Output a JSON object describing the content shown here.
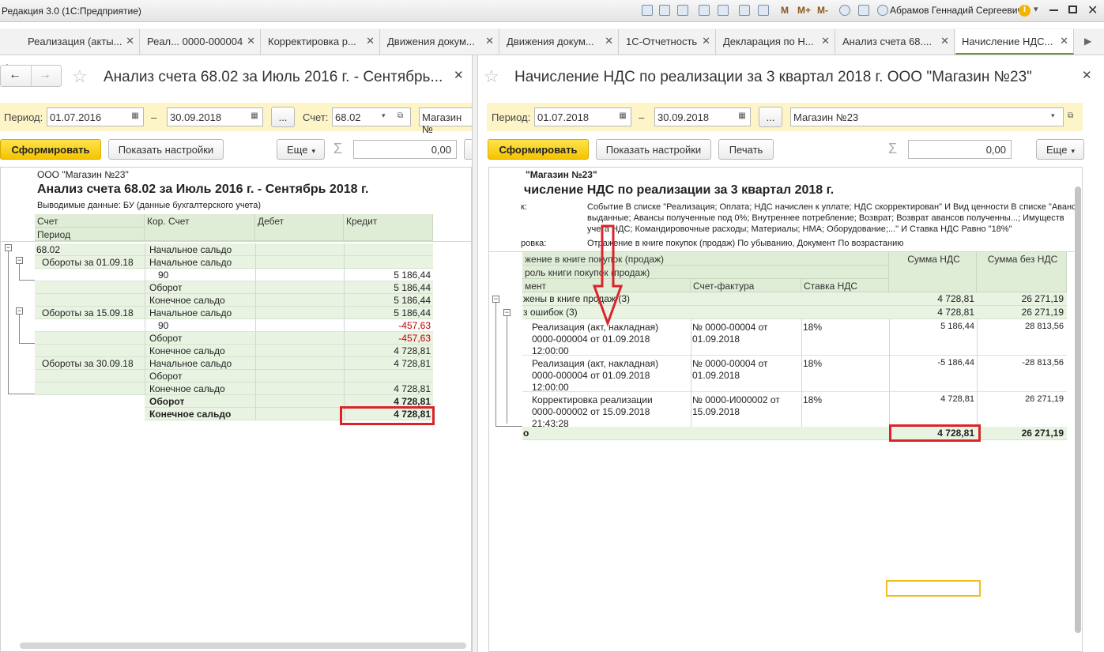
{
  "window": {
    "title": "Редакция 3.0 (1С:Предприятие)",
    "user": "Абрамов Геннадий Сергеевич",
    "m_buttons": [
      "M",
      "M+",
      "M-"
    ]
  },
  "tabs": [
    {
      "label": "Реализация (акты..."
    },
    {
      "label": "Реал... 0000-000004"
    },
    {
      "label": "Корректировка р..."
    },
    {
      "label": "Движения докум..."
    },
    {
      "label": "Движения докум..."
    },
    {
      "label": "1С-Отчетность"
    },
    {
      "label": "Декларация по Н..."
    },
    {
      "label": "Анализ счета 68...."
    },
    {
      "label": "Начисление НДС..."
    }
  ],
  "left": {
    "title": "Анализ счета 68.02 за Июль 2016 г. - Сентябрь...",
    "period_label": "Период:",
    "date_from": "01.07.2016",
    "dash": "–",
    "date_to": "30.09.2018",
    "dots": "...",
    "account_label": "Счет:",
    "account": "68.02",
    "org": "Магазин №",
    "form_btn": "Сформировать",
    "settings_btn": "Показать настройки",
    "more_btn": "Еще",
    "sum_value": "0,00",
    "report": {
      "org": "ООО \"Магазин №23\"",
      "title": "Анализ счета 68.02 за Июль 2016 г. - Сентябрь 2018 г.",
      "output": "Выводимые данные:  БУ (данные бухгалтерского учета)",
      "headers": {
        "account": "Счет",
        "period": "Период",
        "corr": "Кор. Счет",
        "debit": "Дебет",
        "credit": "Кредит"
      },
      "rows": [
        {
          "a": "68.02",
          "c": "Начальное сальдо",
          "k": "",
          "style": "g"
        },
        {
          "a": "Обороты за 01.09.18",
          "c": "Начальное сальдо",
          "k": "",
          "style": "g"
        },
        {
          "a": "",
          "c": "90",
          "k": "5 186,44",
          "style": "w"
        },
        {
          "a": "",
          "c": "Оборот",
          "k": "5 186,44",
          "style": "g"
        },
        {
          "a": "",
          "c": "Конечное сальдо",
          "k": "5 186,44",
          "style": "g"
        },
        {
          "a": "Обороты за 15.09.18",
          "c": "Начальное сальдо",
          "k": "5 186,44",
          "style": "g"
        },
        {
          "a": "",
          "c": "90",
          "k": "-457,63",
          "style": "w"
        },
        {
          "a": "",
          "c": "Оборот",
          "k": "-457,63",
          "style": "g"
        },
        {
          "a": "",
          "c": "Конечное сальдо",
          "k": "4 728,81",
          "style": "g"
        },
        {
          "a": "Обороты за 30.09.18",
          "c": "Начальное сальдо",
          "k": "4 728,81",
          "style": "g"
        },
        {
          "a": "",
          "c": "Оборот",
          "k": "",
          "style": "g"
        },
        {
          "a": "",
          "c": "Конечное сальдо",
          "k": "4 728,81",
          "style": "g"
        },
        {
          "a": "",
          "c": "Оборот",
          "k": "4 728,81",
          "style": "gb"
        },
        {
          "a": "",
          "c": "Конечное сальдо",
          "k": "4 728,81",
          "style": "gb"
        }
      ]
    }
  },
  "right": {
    "title": "Начисление НДС по реализации за 3 квартал 2018 г. ООО \"Магазин №23\"",
    "period_label": "Период:",
    "date_from": "01.07.2018",
    "dash": "–",
    "date_to": "30.09.2018",
    "dots": "...",
    "org": "Магазин №23",
    "form_btn": "Сформировать",
    "settings_btn": "Показать настройки",
    "print_btn": "Печать",
    "more_btn": "Еще",
    "sum_value": "0,00",
    "report": {
      "org": "\"Магазин №23\"",
      "title": "числение НДС по реализации за 3 квартал 2018 г.",
      "f_label": "к:",
      "filter1": "Событие В списке \"Реализация; Оплата; НДС начислен к уплате; НДС скорректирован\" И Вид ценности В списке \"Аванс",
      "filter2": "выданные; Авансы полученные под 0%; Внутреннее потребление; Возврат; Возврат авансов полученны...; Имуществ",
      "filter3": "учета НДС; Командировочные расходы; Материалы; НМА; Оборудование;...\" И Ставка НДС Равно \"18%\"",
      "sort_label": "ровка:",
      "sort": "Отражение в книге покупок (продаж) По убыванию, Документ По возрастанию",
      "h1": "жение в книге покупок (продаж)",
      "h2": "роль книги покупок (продаж)",
      "h3": "мент",
      "h_invoice": "Счет-фактура",
      "h_rate": "Ставка НДС",
      "h_vat": "Сумма НДС",
      "h_novat": "Сумма без НДС",
      "g1": {
        "label": "жены в книге продаж (3)",
        "vat": "4 728,81",
        "novat": "26 271,19"
      },
      "g2": {
        "label": "з ошибок (3)",
        "vat": "4 728,81",
        "novat": "26 271,19"
      },
      "rows": [
        {
          "doc": [
            "Реализация (акт, накладная)",
            "0000-000004 от 01.09.2018",
            "12:00:00"
          ],
          "inv": [
            "№ 0000-00004   от",
            "01.09.2018"
          ],
          "rate": "18%",
          "vat": "5 186,44",
          "novat": "28 813,56"
        },
        {
          "doc": [
            "Реализация (акт, накладная)",
            "0000-000004 от 01.09.2018",
            "12:00:00"
          ],
          "inv": [
            "№ 0000-00004   от",
            "01.09.2018"
          ],
          "rate": "18%",
          "vat": "-5 186,44",
          "novat": "-28 813,56"
        },
        {
          "doc": [
            "Корректировка реализации",
            "0000-000002 от 15.09.2018",
            "21:43:28"
          ],
          "inv": [
            "№ 0000-И000002 от",
            "15.09.2018"
          ],
          "rate": "18%",
          "vat": "4 728,81",
          "novat": "26 271,19"
        }
      ],
      "total": {
        "label": "о",
        "vat": "4 728,81",
        "novat": "26 271,19"
      }
    }
  },
  "colors": {
    "highlight": "#d9252a",
    "green_row": "#e9f3e2",
    "yellow_bar": "#fdf4c7",
    "button": "#f5c400"
  }
}
